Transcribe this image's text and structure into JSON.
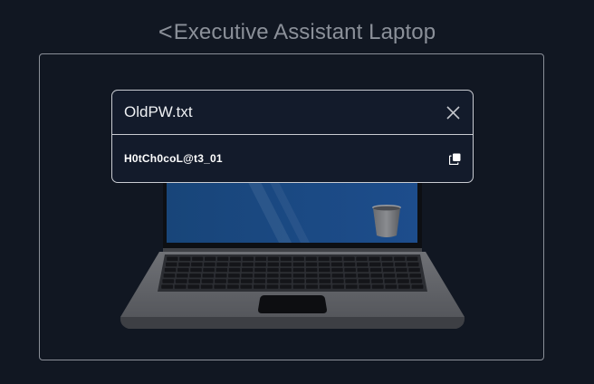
{
  "header": {
    "back_glyph": "<",
    "title": "Executive Assistant Laptop"
  },
  "file_popup": {
    "filename": "OldPW.txt",
    "content": "H0tCh0coL@t3_01"
  },
  "icons": {
    "back": "chevron-left-icon",
    "close": "close-icon",
    "copy": "copy-icon",
    "trash": "trash-can-icon"
  },
  "colors": {
    "background": "#111722",
    "popup_background": "#131b2b",
    "border": "#c9ccd2",
    "header_text": "#8b9099",
    "screen_blue": "#1d4a86"
  }
}
